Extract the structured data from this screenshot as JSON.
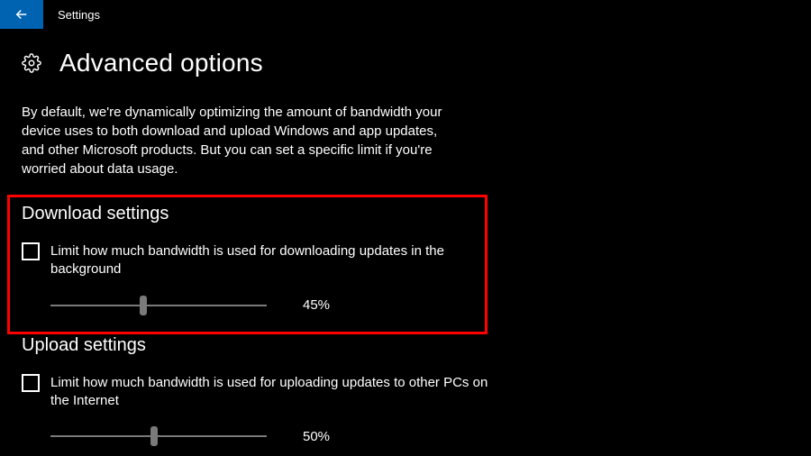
{
  "header": {
    "title": "Settings"
  },
  "page": {
    "title": "Advanced options",
    "description": "By default, we're dynamically optimizing the amount of bandwidth your device uses to both download and upload Windows and app updates, and other Microsoft products. But you can set a specific limit if you're worried about data usage."
  },
  "download": {
    "heading": "Download settings",
    "checkbox_label": "Limit how much bandwidth is used for downloading updates in the background",
    "slider_value": 45,
    "slider_display": "45%"
  },
  "upload": {
    "heading": "Upload settings",
    "checkbox_label": "Limit how much bandwidth is used for uploading updates to other PCs on the Internet",
    "slider_value": 50,
    "slider_display": "50%"
  }
}
